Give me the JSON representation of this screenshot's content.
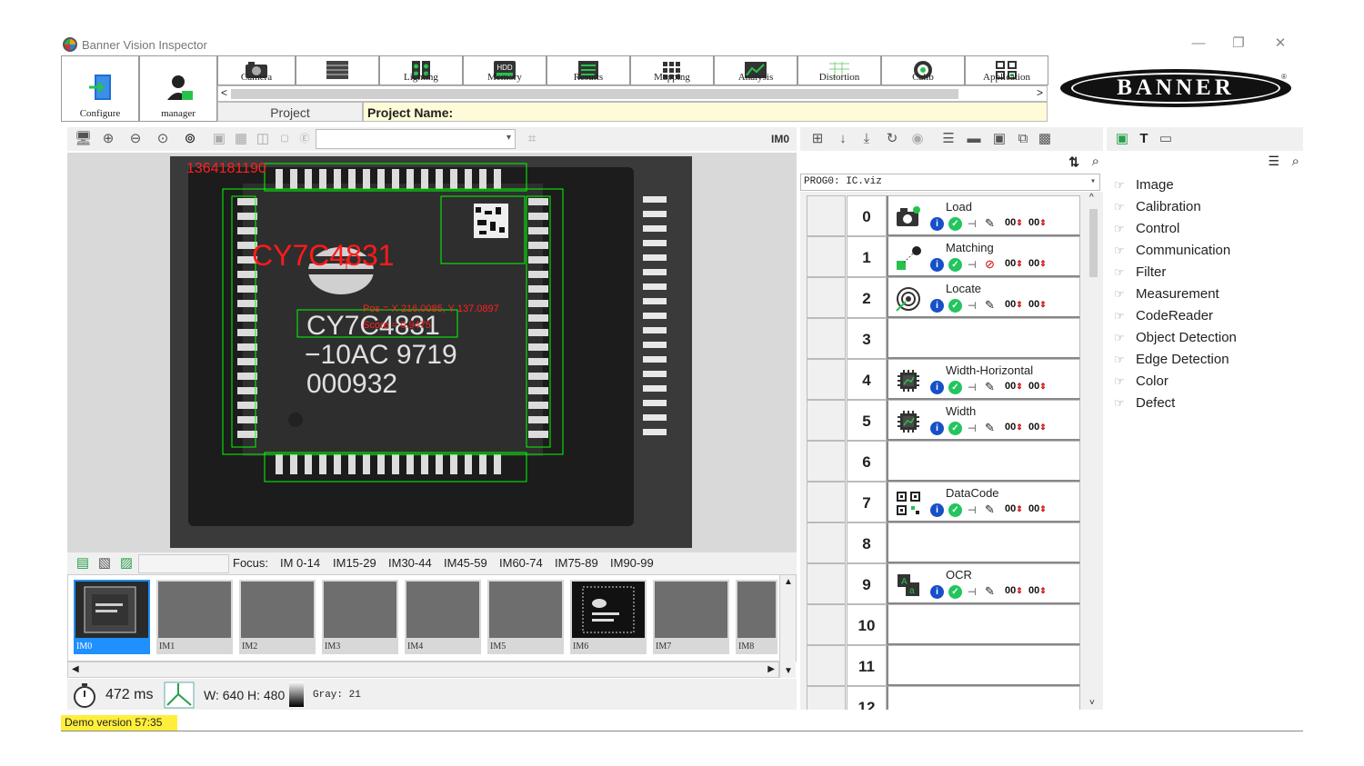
{
  "window": {
    "title": "Banner Vision Inspector",
    "minimize": "—",
    "restore": "❐",
    "close": "✕"
  },
  "toolbar": {
    "configure_label": "Configure",
    "user_label": "manager",
    "modules": [
      "Camera",
      "",
      "Lighting",
      "Memory",
      "Results",
      "Mapping",
      "Analysis",
      "Distortion",
      "Calib",
      "Application"
    ],
    "scroll_left": "<",
    "scroll_right": ">",
    "project_label": "Project",
    "project_name_label": "Project Name:"
  },
  "brand": {
    "logo_text": "BANNER",
    "reg": "®"
  },
  "viewer": {
    "image_id": "IM0",
    "overlay": {
      "serial": "1364181190",
      "ocr_top": "CY7C4831",
      "pos": "Pos = X 216.0085, Y 137.0897",
      "score": "Score = 0.9475"
    },
    "chip_text": [
      "CY7C4831",
      "−10AC 9719",
      "000932"
    ]
  },
  "focus": {
    "label": "Focus:",
    "ranges": [
      "IM 0-14",
      "IM15-29",
      "IM30-44",
      "IM45-59",
      "IM60-74",
      "IM75-89",
      "IM90-99"
    ]
  },
  "thumbnails": [
    "IM0",
    "IM1",
    "IM2",
    "IM3",
    "IM4",
    "IM5",
    "IM6",
    "IM7",
    "IM8"
  ],
  "status": {
    "time": "472 ms",
    "size": "W: 640  H: 480",
    "gray": "Gray: 21",
    "demo": "Demo version  57:35"
  },
  "program": {
    "file": "PROG0: IC.viz",
    "steps": [
      {
        "num": "0",
        "name": "Load",
        "icon": "camera-icon"
      },
      {
        "num": "1",
        "name": "Matching",
        "icon": "matching-icon"
      },
      {
        "num": "2",
        "name": "Locate",
        "icon": "target-icon"
      },
      {
        "num": "3",
        "name": "",
        "icon": ""
      },
      {
        "num": "4",
        "name": "Width-Horizontal",
        "icon": "chip-icon"
      },
      {
        "num": "5",
        "name": "Width",
        "icon": "chip-icon"
      },
      {
        "num": "6",
        "name": "",
        "icon": ""
      },
      {
        "num": "7",
        "name": "DataCode",
        "icon": "qr-icon"
      },
      {
        "num": "8",
        "name": "",
        "icon": ""
      },
      {
        "num": "9",
        "name": "OCR",
        "icon": "ocr-icon"
      },
      {
        "num": "10",
        "name": "",
        "icon": ""
      },
      {
        "num": "11",
        "name": "",
        "icon": ""
      },
      {
        "num": "12",
        "name": "",
        "icon": ""
      }
    ],
    "counter": "00"
  },
  "library": {
    "items": [
      "Image",
      "Calibration",
      "Control",
      "Communication",
      "Filter",
      "Measurement",
      "CodeReader",
      "Object Detection",
      "Edge Detection",
      "Color",
      "Defect"
    ]
  },
  "colors": {
    "accent": "#1e90ff",
    "overlay_green": "#00ff00",
    "overlay_red": "#ff2020",
    "demo_bg": "#ffef3b"
  }
}
